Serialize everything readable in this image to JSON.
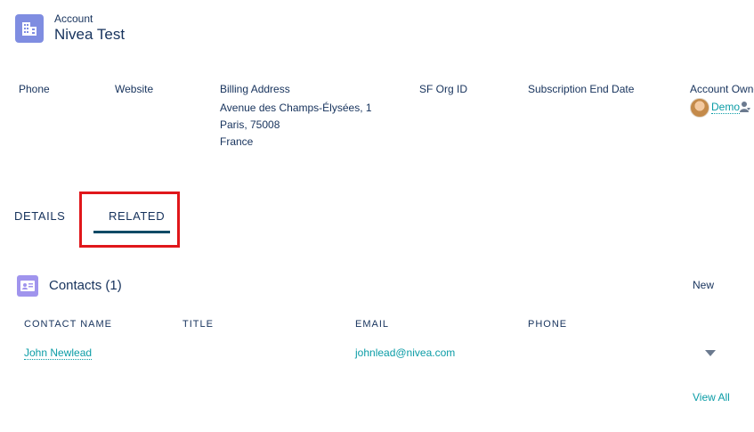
{
  "header": {
    "object_type": "Account",
    "record_name": "Nivea Test",
    "icon": "building-icon"
  },
  "fields": {
    "phone_label": "Phone",
    "website_label": "Website",
    "billing_address_label": "Billing Address",
    "billing_address_lines": [
      "Avenue des Champs-Élysées, 1",
      "Paris, 75008",
      "France"
    ],
    "sf_org_id_label": "SF Org ID",
    "subscription_end_label": "Subscription End Date",
    "owner_label": "Account Owner",
    "owner_name": "Demo",
    "owner_change_icon": "change-owner-icon"
  },
  "tabs": {
    "details": "DETAILS",
    "related": "RELATED",
    "active": "RELATED"
  },
  "related_list": {
    "icon": "contact-card-icon",
    "title": "Contacts (1)",
    "new_label": "New",
    "columns": [
      "CONTACT NAME",
      "TITLE",
      "EMAIL",
      "PHONE"
    ],
    "rows": [
      {
        "name": "John Newlead",
        "title": "",
        "email": "johnlead@nivea.com",
        "phone": ""
      }
    ],
    "view_all_label": "View All"
  },
  "colors": {
    "accent_link": "#0b9ca6",
    "text": "#16325c",
    "highlight": "#e0171b",
    "account_icon_bg": "#7f8de1",
    "contacts_icon_bg": "#a094ed"
  }
}
